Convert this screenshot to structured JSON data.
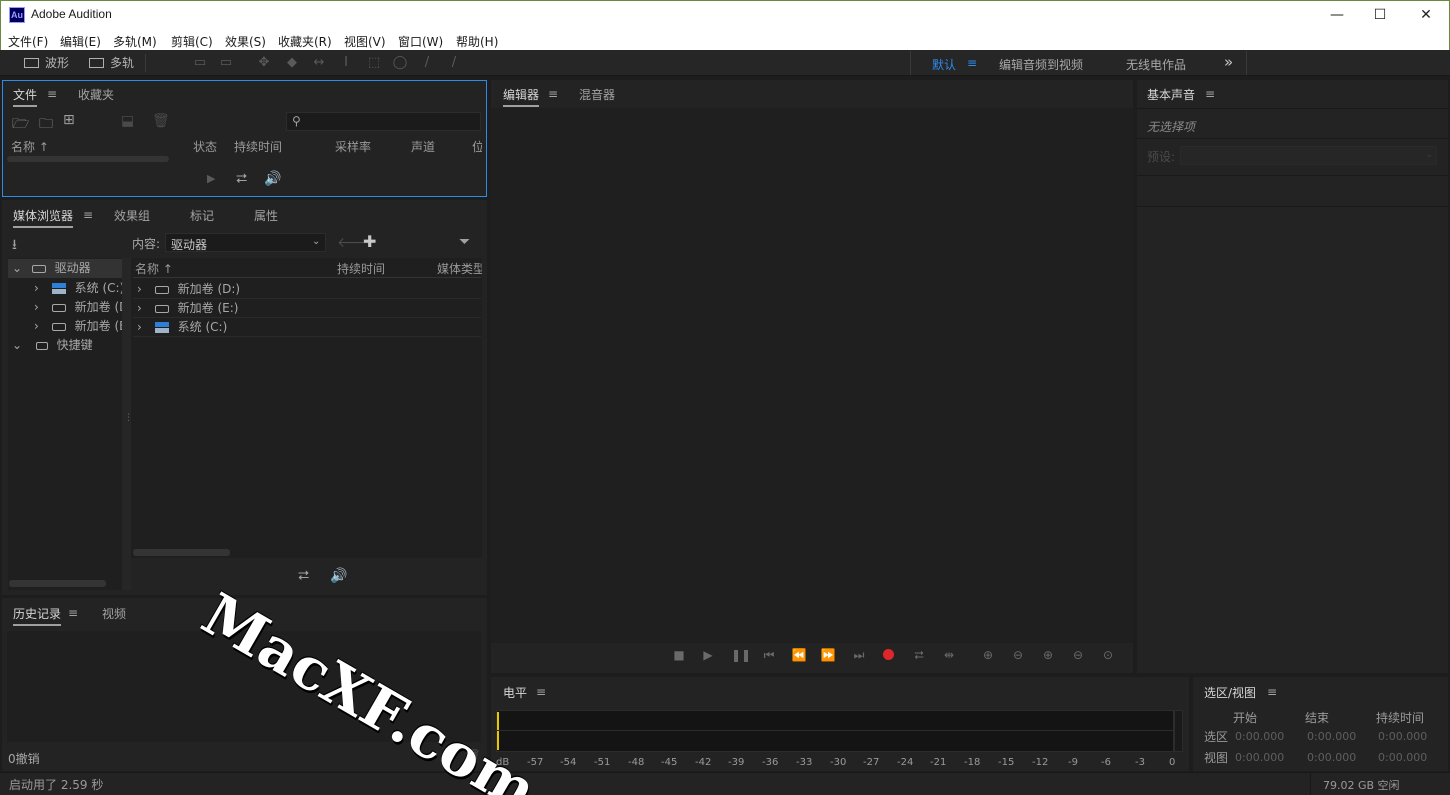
{
  "window": {
    "title": "Adobe Audition",
    "icon_text": "Au"
  },
  "menu": [
    "文件(F)",
    "编辑(E)",
    "多轨(M)",
    "剪辑(C)",
    "效果(S)",
    "收藏夹(R)",
    "视图(V)",
    "窗口(W)",
    "帮助(H)"
  ],
  "toolbar": {
    "waveform_label": "波形",
    "multitrack_label": "多轨"
  },
  "workspaces": {
    "items": [
      "默认",
      "编辑音频到视频",
      "无线电作品"
    ],
    "active": "默认",
    "more": "»"
  },
  "files_panel": {
    "tabs": [
      "文件",
      "收藏夹"
    ],
    "columns": [
      "名称 ↑",
      "状态",
      "持续时间",
      "采样率",
      "声道",
      "位"
    ]
  },
  "media_browser": {
    "tabs": [
      "媒体浏览器",
      "效果组",
      "标记",
      "属性"
    ],
    "content_label": "内容:",
    "content_value": "驱动器",
    "tree": [
      {
        "label": "驱动器",
        "expanded": true,
        "icon": "drive-group-icon"
      },
      {
        "label": "系统 (C:)",
        "icon": "windows-drive-icon"
      },
      {
        "label": "新加卷 (D:)",
        "icon": "drive-icon"
      },
      {
        "label": "新加卷 (E:)",
        "icon": "drive-icon"
      },
      {
        "label": "快捷键",
        "expanded": true,
        "icon": "shortcut-icon"
      }
    ],
    "columns": [
      "名称 ↑",
      "持续时间",
      "媒体类型"
    ],
    "rows": [
      {
        "label": "新加卷 (D:)",
        "icon": "drive-icon"
      },
      {
        "label": "新加卷 (E:)",
        "icon": "drive-icon"
      },
      {
        "label": "系统 (C:)",
        "icon": "windows-drive-icon"
      }
    ]
  },
  "history_panel": {
    "tabs": [
      "历史记录",
      "视频"
    ],
    "undo_count": "0撤销"
  },
  "editor": {
    "tabs": [
      "编辑器",
      "混音器"
    ]
  },
  "essential_sound": {
    "title": "基本声音",
    "no_selection": "无选择项",
    "preset_label": "预设:"
  },
  "levels": {
    "title": "电平",
    "ticks": [
      "dB",
      "-57",
      "-54",
      "-51",
      "-48",
      "-45",
      "-42",
      "-39",
      "-36",
      "-33",
      "-30",
      "-27",
      "-24",
      "-21",
      "-18",
      "-15",
      "-12",
      "-9",
      "-6",
      "-3",
      "0"
    ]
  },
  "selection_view": {
    "title": "选区/视图",
    "headers": [
      "开始",
      "结束",
      "持续时间"
    ],
    "rows": [
      {
        "label": "选区",
        "start": "0:00.000",
        "end": "0:00.000",
        "duration": "0:00.000"
      },
      {
        "label": "视图",
        "start": "0:00.000",
        "end": "0:00.000",
        "duration": "0:00.000"
      }
    ]
  },
  "status": {
    "startup": "启动用了 2.59 秒",
    "disk_free": "79.02 GB 空闲"
  },
  "watermark": "MacXF.com",
  "colors": {
    "accent_blue": "#2d8ceb",
    "record_red": "#e0262b",
    "meter_yellow": "#e8c800",
    "frame_green": "#6a8a40"
  }
}
